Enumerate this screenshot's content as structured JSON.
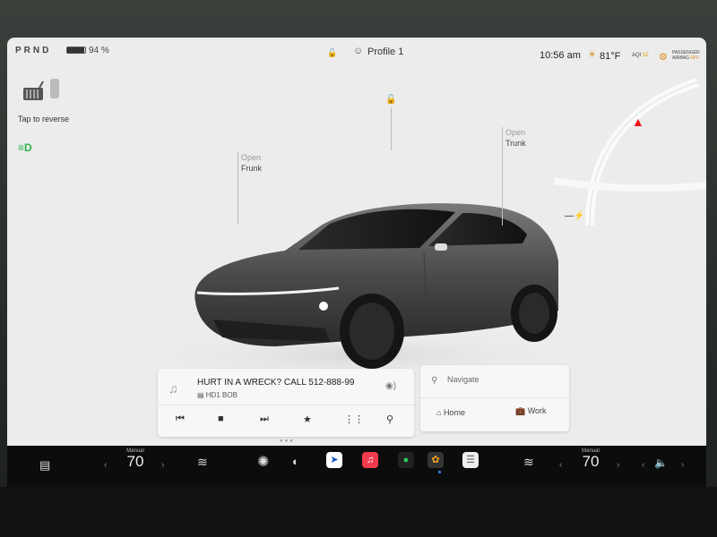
{
  "status_bar": {
    "gear": "PRND",
    "battery_pct": "94 %",
    "battery_level": 0.94,
    "profile": "Profile 1",
    "time": "10:56 am",
    "temperature": "81°F",
    "aqi_label": "AQI",
    "aqi_value": "52",
    "airbag_line1": "PASSENGER",
    "airbag_line2": "AIRBAG",
    "airbag_state": "OFF"
  },
  "left": {
    "reverse_label": "Tap to reverse"
  },
  "car": {
    "frunk_open": "Open",
    "frunk_label": "Frunk",
    "trunk_open": "Open",
    "trunk_label": "Trunk"
  },
  "media": {
    "song": "HURT IN A WRECK? CALL 512-888-99",
    "station": "HD1 BOB"
  },
  "navigate": {
    "placeholder": "Navigate",
    "home": "Home",
    "work": "Work"
  },
  "dock": {
    "driver_temp_label": "Manual",
    "driver_temp": "70",
    "passenger_temp_label": "Manual",
    "passenger_temp": "70"
  },
  "colors": {
    "accent_green": "#2db34a",
    "nav_arrow": "#e11111",
    "warning_orange": "#e08a10"
  }
}
